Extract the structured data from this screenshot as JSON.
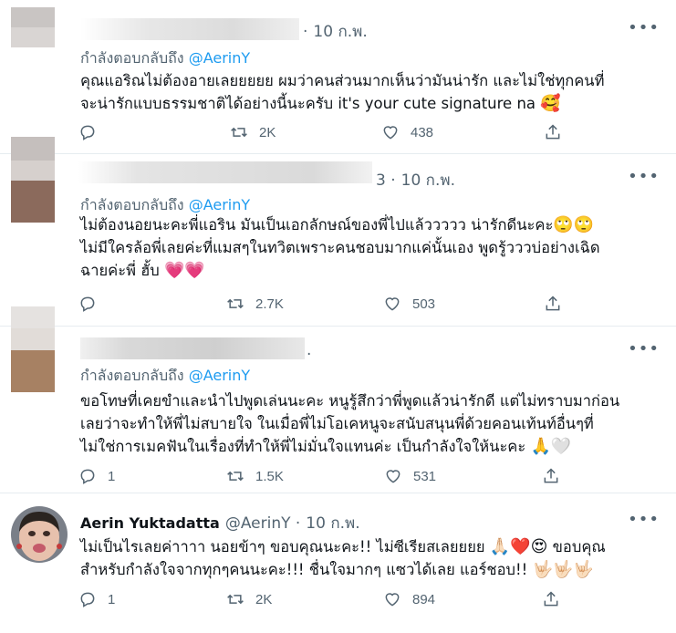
{
  "tweets": [
    {
      "time": "10 ก.พ.",
      "reply_prefix": "กำลังตอบกลับถึง",
      "reply_handle": "@AerinY",
      "lines": [
        "คุณแอริณไม่ต้องอายเลยยยยย ผมว่าคนส่วนมากเห็นว่ามันน่ารัก และไม่ใช่ทุกคนที่",
        "จะน่ารักแบบธรรมชาติได้อย่างนี้นะครับ it's your cute signature na"
      ],
      "emoji_line2": "🥰",
      "reply_count": "",
      "retweet_count": "2K",
      "like_count": "438"
    },
    {
      "time": "10 ก.พ.",
      "time_fragment": "3",
      "reply_prefix": "กำลังตอบกลับถึง",
      "reply_handle": "@AerinY",
      "lines": [
        "ไม่ต้องนอยนะคะพี่แอริน มันเป็นเอกลักษณ์ของพี่ไปแล้ววววว น่ารักดีนะคะ",
        "ไม่มีใครล้อพี่เลยค่ะที่แมสๆในทวิตเพราะคนชอบมากแค่นั้นเอง พูดรู้วววบ่อย่างเฉิด",
        "ฉายค่ะพี่ ฮั้บ"
      ],
      "emoji_line1": "🙄🙄",
      "emoji_line3": "💗💗",
      "reply_count": "",
      "retweet_count": "2.7K",
      "like_count": "503"
    },
    {
      "reply_prefix": "กำลังตอบกลับถึง",
      "reply_handle": "@AerinY",
      "lines": [
        "ขอโทษที่เคยขำและนำไปพูดเล่นนะคะ หนูรู้สึกว่าพี่พูดแล้วน่ารักดี แต่ไม่ทราบมาก่อน",
        "เลยว่าจะทำให้พี่ไม่สบายใจ ในเมื่อพี่ไม่โอเคหนูจะสนับสนุนพี่ด้วยคอนเท้นท์อื่นๆที่",
        "ไม่ใช่การเมคฟันในเรื่องที่ทำให้พี่ไม่มั่นใจแทนค่ะ เป็นกำลังใจให้นะคะ"
      ],
      "emoji_line3": "🙏🤍",
      "reply_count": "1",
      "retweet_count": "1.5K",
      "like_count": "531"
    },
    {
      "author_name": "Aerin Yuktadatta",
      "author_handle": "@AerinY",
      "time": "10 ก.พ.",
      "lines": [
        "ไม่เป็นไรเลยค่าาาา นอยข้าๆ ขอบคุณนะคะ!! ไม่ซีเรียสเลยยยย",
        "สำหรับกำลังใจจากทุกๆคนนะคะ!!! ชื่นใจมากๆ แซวได้เลย แอร์ชอบ!!"
      ],
      "line1_tail": "ขอบคุณ",
      "emoji_line1": "🙏🏻❤️😍",
      "emoji_line2": "🤟🏻🤟🏻🤟🏻",
      "reply_count": "1",
      "retweet_count": "2K",
      "like_count": "894"
    }
  ],
  "icons": {
    "reply": "reply-icon",
    "retweet": "retweet-icon",
    "like": "heart-icon",
    "share": "share-icon",
    "more": "more-icon"
  },
  "colors": {
    "link": "#1d9bf0",
    "muted": "#536471",
    "text": "#0f1419",
    "divider": "#e6ecf0"
  }
}
